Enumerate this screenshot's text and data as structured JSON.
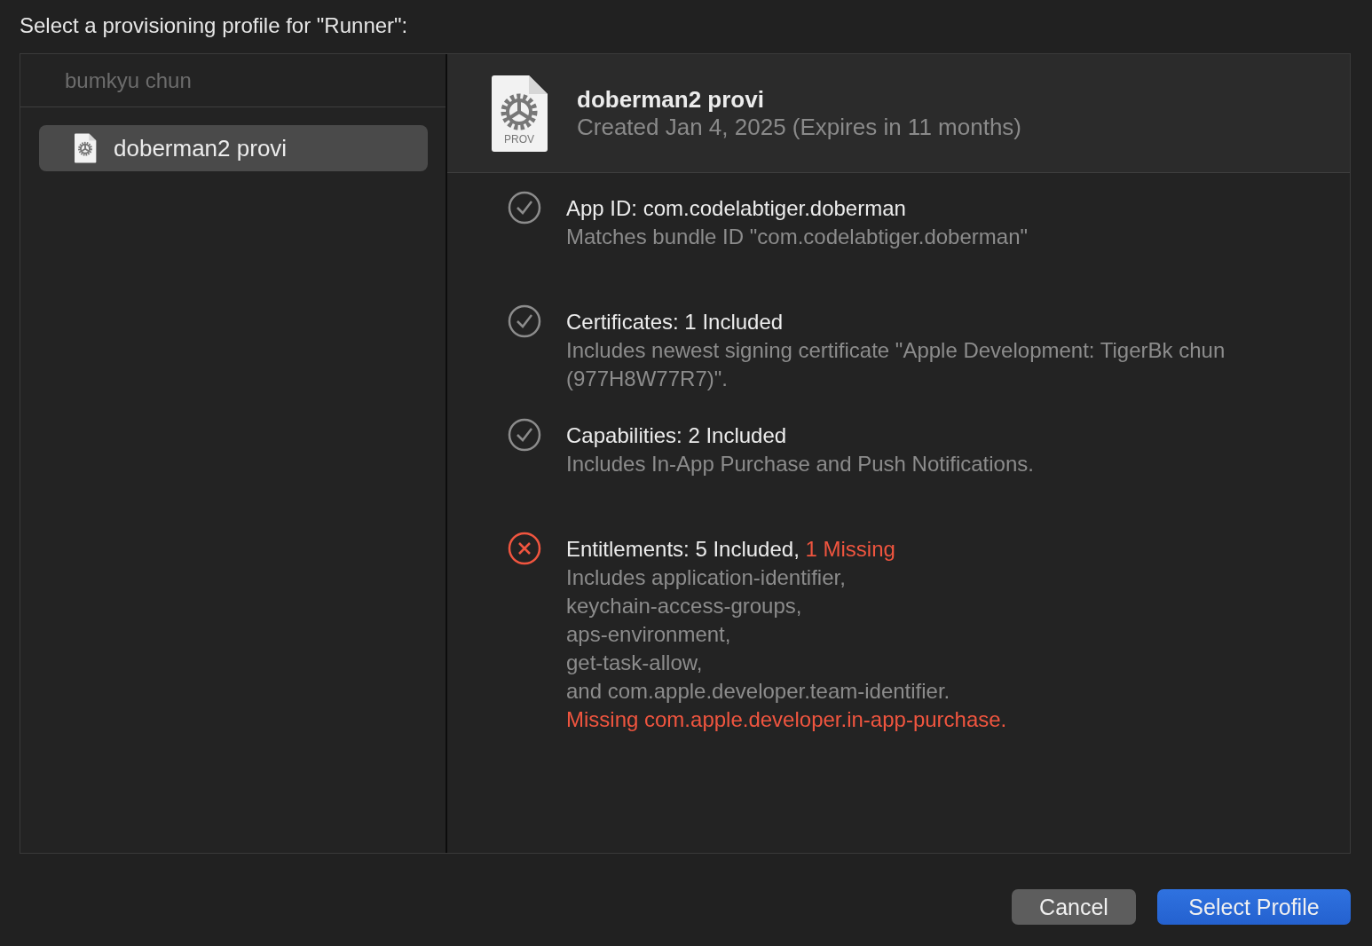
{
  "dialog": {
    "title": "Select a provisioning profile for \"Runner\":"
  },
  "sidebar": {
    "header": "bumkyu chun",
    "items": [
      {
        "label": "doberman2 provi",
        "selected": true
      }
    ]
  },
  "profile": {
    "name": "doberman2 provi",
    "file_badge": "PROV",
    "created": "Created Jan 4, 2025 (Expires in 11 months)"
  },
  "checks": [
    {
      "ok": true,
      "title": "App ID: com.codelabtiger.doberman",
      "lines": [
        "Matches bundle ID \"com.codelabtiger.doberman\""
      ]
    },
    {
      "ok": true,
      "title": "Certificates: 1 Included",
      "lines": [
        "Includes newest signing certificate \"Apple Development: TigerBk chun (977H8W77R7)\"."
      ]
    },
    {
      "ok": true,
      "title": "Capabilities: 2 Included",
      "lines": [
        "Includes In-App Purchase and Push Notifications."
      ]
    },
    {
      "ok": false,
      "title": "Entitlements: 5 Included,",
      "alert": "1 Missing",
      "lines": [
        "Includes application-identifier,",
        "keychain-access-groups,",
        "aps-environment,",
        "get-task-allow,",
        "and com.apple.developer.team-identifier."
      ],
      "missing": "Missing com.apple.developer.in-app-purchase."
    }
  ],
  "buttons": [
    {
      "label": "Cancel",
      "kind": "secondary"
    },
    {
      "label": "Select Profile",
      "kind": "primary"
    }
  ]
}
